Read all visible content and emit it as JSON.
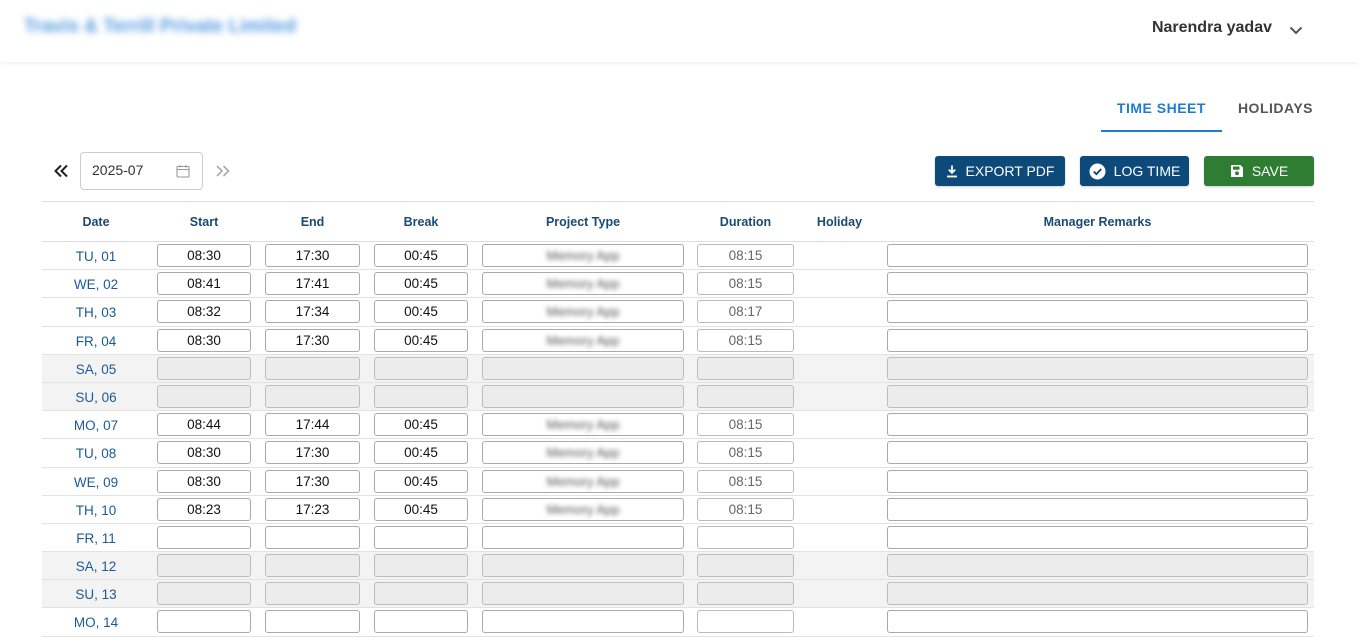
{
  "header": {
    "company": "Travis & Terrill Private Limited",
    "user_name": "Narendra yadav",
    "user_menu_icon": "chevron-down-icon"
  },
  "tabs": [
    {
      "label": "TIME SHEET",
      "active": true
    },
    {
      "label": "HOLIDAYS",
      "active": false
    }
  ],
  "toolbar": {
    "month": "2025-07",
    "export_label": "EXPORT PDF",
    "log_label": "LOG TIME",
    "save_label": "SAVE"
  },
  "colors": {
    "accent": "#1e7bd6",
    "primary_button": "#0d4a7a",
    "save_button": "#2e7d32"
  },
  "table": {
    "columns": [
      "Date",
      "Start",
      "End",
      "Break",
      "Project Type",
      "Duration",
      "Holiday",
      "Manager Remarks"
    ],
    "rows": [
      {
        "date": "TU, 01",
        "start": "08:30",
        "end": "17:30",
        "break": "00:45",
        "project": "Memory App",
        "duration": "08:15",
        "holiday": "",
        "remarks": "",
        "weekend": false
      },
      {
        "date": "WE, 02",
        "start": "08:41",
        "end": "17:41",
        "break": "00:45",
        "project": "Memory App",
        "duration": "08:15",
        "holiday": "",
        "remarks": "",
        "weekend": false
      },
      {
        "date": "TH, 03",
        "start": "08:32",
        "end": "17:34",
        "break": "00:45",
        "project": "Memory App",
        "duration": "08:17",
        "holiday": "",
        "remarks": "",
        "weekend": false
      },
      {
        "date": "FR, 04",
        "start": "08:30",
        "end": "17:30",
        "break": "00:45",
        "project": "Memory App",
        "duration": "08:15",
        "holiday": "",
        "remarks": "",
        "weekend": false
      },
      {
        "date": "SA, 05",
        "start": "",
        "end": "",
        "break": "",
        "project": "",
        "duration": "",
        "holiday": "",
        "remarks": "",
        "weekend": true
      },
      {
        "date": "SU, 06",
        "start": "",
        "end": "",
        "break": "",
        "project": "",
        "duration": "",
        "holiday": "",
        "remarks": "",
        "weekend": true
      },
      {
        "date": "MO, 07",
        "start": "08:44",
        "end": "17:44",
        "break": "00:45",
        "project": "Memory App",
        "duration": "08:15",
        "holiday": "",
        "remarks": "",
        "weekend": false
      },
      {
        "date": "TU, 08",
        "start": "08:30",
        "end": "17:30",
        "break": "00:45",
        "project": "Memory App",
        "duration": "08:15",
        "holiday": "",
        "remarks": "",
        "weekend": false
      },
      {
        "date": "WE, 09",
        "start": "08:30",
        "end": "17:30",
        "break": "00:45",
        "project": "Memory App",
        "duration": "08:15",
        "holiday": "",
        "remarks": "",
        "weekend": false
      },
      {
        "date": "TH, 10",
        "start": "08:23",
        "end": "17:23",
        "break": "00:45",
        "project": "Memory App",
        "duration": "08:15",
        "holiday": "",
        "remarks": "",
        "weekend": false
      },
      {
        "date": "FR, 11",
        "start": "",
        "end": "",
        "break": "",
        "project": "",
        "duration": "",
        "holiday": "",
        "remarks": "",
        "weekend": false
      },
      {
        "date": "SA, 12",
        "start": "",
        "end": "",
        "break": "",
        "project": "",
        "duration": "",
        "holiday": "",
        "remarks": "",
        "weekend": true
      },
      {
        "date": "SU, 13",
        "start": "",
        "end": "",
        "break": "",
        "project": "",
        "duration": "",
        "holiday": "",
        "remarks": "",
        "weekend": true
      },
      {
        "date": "MO, 14",
        "start": "",
        "end": "",
        "break": "",
        "project": "",
        "duration": "",
        "holiday": "",
        "remarks": "",
        "weekend": false
      }
    ]
  }
}
